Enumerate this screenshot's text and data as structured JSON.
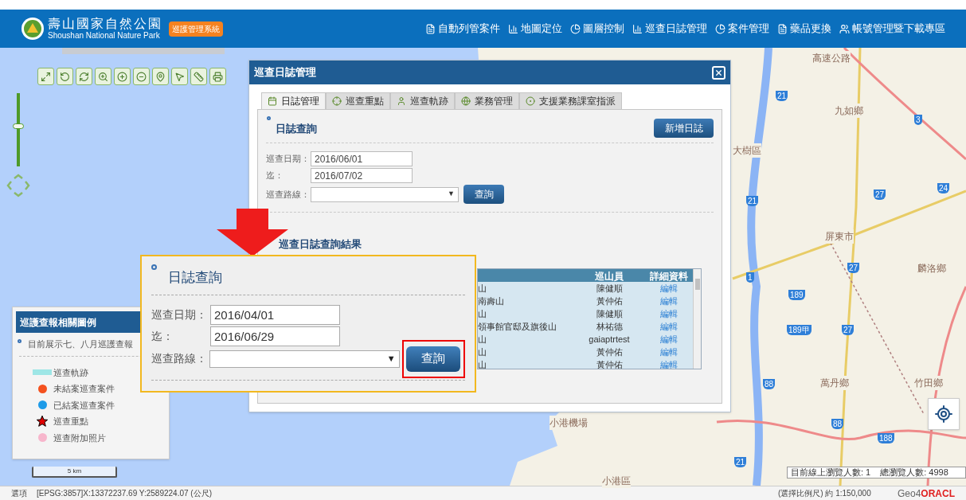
{
  "header": {
    "title": "壽山國家自然公園",
    "subtitle": "Shoushan National Nature Park",
    "badge": "巡護管理系統",
    "nav": [
      {
        "label": "自動列管案件"
      },
      {
        "label": "地圖定位"
      },
      {
        "label": "圖層控制"
      },
      {
        "label": "巡查日誌管理"
      },
      {
        "label": "案件管理"
      },
      {
        "label": "藥品更換"
      },
      {
        "label": "帳號管理暨下載專區"
      }
    ]
  },
  "zoom_slider": {
    "level": 0.55
  },
  "map": {
    "labels": [
      "九如鄉",
      "大樹區",
      "屏東市",
      "麟洛鄉",
      "萬丹鄉",
      "竹田鄉",
      "小港區",
      "小港機場",
      "高速公路"
    ],
    "shields": [
      "21",
      "21",
      "27",
      "27",
      "27",
      "24",
      "3",
      "1",
      "189",
      "189甲",
      "88",
      "88",
      "188",
      "21"
    ]
  },
  "legend": {
    "title": "巡護查報相關圖例",
    "note": "目前展示七、八月巡護查報",
    "items": [
      {
        "kind": "line",
        "color": "#9ee6e6",
        "label": "巡查軌跡"
      },
      {
        "kind": "dot",
        "color": "#f4511e",
        "label": "未結案巡查案件"
      },
      {
        "kind": "dot",
        "color": "#1e9be8",
        "label": "已結案巡查案件"
      },
      {
        "kind": "star",
        "color": "#e00000",
        "label": "巡查重點"
      },
      {
        "kind": "dot",
        "color": "#f7b6cc",
        "label": "巡查附加照片"
      }
    ]
  },
  "scale": "5 km",
  "dialog": {
    "title": "巡查日誌管理",
    "tabs": [
      {
        "label": "日誌管理",
        "selected": true
      },
      {
        "label": "巡查重點",
        "selected": false
      },
      {
        "label": "巡查軌跡",
        "selected": false
      },
      {
        "label": "業務管理",
        "selected": false
      },
      {
        "label": "支援業務課室指派",
        "selected": false
      }
    ],
    "section": "日誌查詢",
    "add_button": "新增日誌",
    "fields": [
      {
        "label": "巡查日期：",
        "value": "2016/06/01"
      },
      {
        "label": "迄：",
        "value": "2016/07/02"
      }
    ],
    "route_label": "巡查路線：",
    "route_caret": "▼",
    "search_button": "查詢",
    "results_title": "巡查日誌查詢結果",
    "table": {
      "columns": [
        "巡山員",
        "詳細資料"
      ],
      "rows": [
        {
          "column_1": "山",
          "patroller": "陳健順",
          "detail": "編輯"
        },
        {
          "column_1": "南壽山",
          "patroller": "黃仲佑",
          "detail": "編輯"
        },
        {
          "column_1": "山",
          "patroller": "陳健順",
          "detail": "編輯"
        },
        {
          "column_1": "領事館官邸及旗後山",
          "patroller": "林祐德",
          "detail": "編輯"
        },
        {
          "column_1": "山",
          "patroller": "gaiaptrtest",
          "detail": "編輯"
        },
        {
          "column_1": "山",
          "patroller": "黃仲佑",
          "detail": "編輯"
        },
        {
          "column_1": "山",
          "patroller": "黃仲佑",
          "detail": "編輯"
        }
      ]
    }
  },
  "callout": {
    "section": "日誌查詢",
    "fields": [
      {
        "label": "巡查日期：",
        "value": "2016/04/01"
      },
      {
        "label": "迄：",
        "value": "2016/06/29"
      }
    ],
    "route_label": "巡查路線：",
    "route_caret": "▼",
    "search_button": "查詢"
  },
  "counter": {
    "online": "目前線上瀏覽人數: 1",
    "total": "總瀏覽人數: 4998"
  },
  "status_bar": {
    "options": "選項",
    "coords": "[EPSG:3857]X:13372237.69 Y:2589224.07 (公尺)",
    "scale": "(選擇比例尺) 約 1:150,000",
    "brand_a": "Geo4",
    "brand_b": "ORACL"
  }
}
